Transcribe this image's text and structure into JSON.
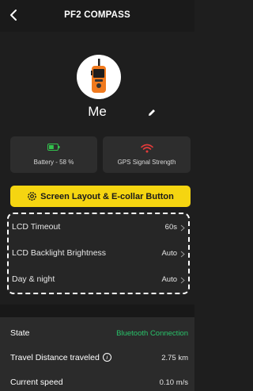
{
  "header": {
    "title": "PF2 COMPASS",
    "back_icon": "chevron-left-icon"
  },
  "profile": {
    "name": "Me",
    "avatar_icon": "orange-gps-device-icon",
    "edit_icon": "pencil-icon"
  },
  "status_cards": {
    "battery": {
      "label": "Battery - 58 %",
      "level": 0.58,
      "icon": "battery-icon",
      "color": "#33c24d"
    },
    "gps": {
      "label": "GPS Signal Strength",
      "icon": "wifi-signal-icon",
      "color": "#e23b3b"
    }
  },
  "layout_button": {
    "label": "Screen Layout & E-collar Button",
    "icon": "gear-icon",
    "color": "#f5d511"
  },
  "settings": [
    {
      "label": "LCD Timeout",
      "value": "60s"
    },
    {
      "label": "LCD Backlight Brightness",
      "value": "Auto"
    },
    {
      "label": "Day & night",
      "value": "Auto"
    }
  ],
  "info": {
    "state": {
      "label": "State",
      "value": "Bluetooth Connection",
      "value_color": "#29c36a"
    },
    "distance": {
      "label": "Travel Distance traveled",
      "value": "2.75 km",
      "info_icon": "i"
    },
    "speed": {
      "label": "Current speed",
      "value": "0.10 m/s"
    }
  }
}
